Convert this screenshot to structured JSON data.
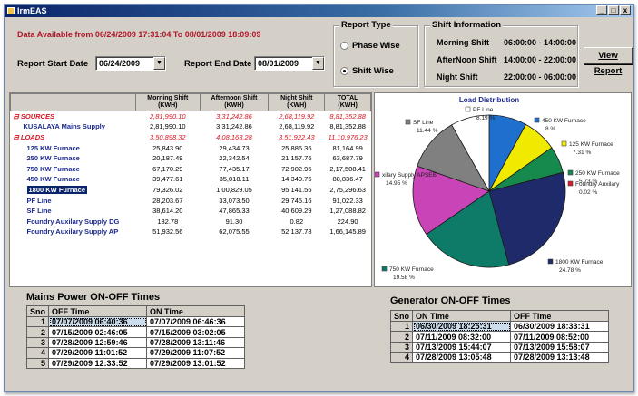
{
  "window": {
    "title": "IrmEAS",
    "min": "_",
    "max": "□",
    "close": "x"
  },
  "header": {
    "availability": "Data Available from 06/24/2009 17:31:04 To 08/01/2009 18:09:09",
    "start_label": "Report Start Date",
    "start_value": "06/24/2009",
    "end_label": "Report End Date",
    "end_value": "08/01/2009"
  },
  "report_type": {
    "title": "Report Type",
    "options": [
      "Phase Wise",
      "Shift Wise"
    ],
    "selected": "Shift Wise"
  },
  "shift_info": {
    "title": "Shift Information",
    "rows": [
      {
        "name": "Morning Shift",
        "time": "06:00:00 - 14:00:00"
      },
      {
        "name": "AfterNoon Shift",
        "time": "14:00:00 - 22:00:00"
      },
      {
        "name": "Night Shift",
        "time": "22:00:00 - 06:00:00"
      }
    ]
  },
  "view_button": "View Report",
  "grid": {
    "headers": [
      "",
      "Morning Shift (KWH)",
      "Afternoon Shift (KWH)",
      "Night Shift (KWH)",
      "TOTAL (KWH)"
    ],
    "rows": [
      {
        "name": "⊟ SOURCES",
        "m": "2,81,990.10",
        "a": "3,31,242.86",
        "n": "2,68,119.92",
        "t": "8,81,352.88",
        "kind": "group"
      },
      {
        "name": "KUSALAYA Mains Supply",
        "m": "2,81,990.10",
        "a": "3,31,242.86",
        "n": "2,68,119.92",
        "t": "8,81,352.88",
        "kind": "item"
      },
      {
        "name": "⊟ LOADS",
        "m": "3,50,898.32",
        "a": "4,08,163.28",
        "n": "3,51,922.43",
        "t": "11,10,976.23",
        "kind": "group"
      },
      {
        "name": "125 KW Furnace",
        "m": "25,843.90",
        "a": "29,434.73",
        "n": "25,886.36",
        "t": "81,164.99",
        "kind": "load"
      },
      {
        "name": "250 KW Furnace",
        "m": "20,187.49",
        "a": "22,342.54",
        "n": "21,157.76",
        "t": "63,687.79",
        "kind": "load"
      },
      {
        "name": "750 KW Furnace",
        "m": "67,170.29",
        "a": "77,435.17",
        "n": "72,902.95",
        "t": "2,17,508.41",
        "kind": "load"
      },
      {
        "name": "450 KW Furnace",
        "m": "39,477.61",
        "a": "35,018.11",
        "n": "14,340.75",
        "t": "88,836.47",
        "kind": "load"
      },
      {
        "name": "1800 KW Furnace",
        "m": "79,326.02",
        "a": "1,00,829.05",
        "n": "95,141.56",
        "t": "2,75,296.63",
        "kind": "sel"
      },
      {
        "name": "PF Line",
        "m": "28,203.67",
        "a": "33,073.50",
        "n": "29,745.16",
        "t": "91,022.33",
        "kind": "load"
      },
      {
        "name": "SF Line",
        "m": "38,614.20",
        "a": "47,865.33",
        "n": "40,609.29",
        "t": "1,27,088.82",
        "kind": "load"
      },
      {
        "name": "Foundry Auxilary Supply DG",
        "m": "132.78",
        "a": "91.30",
        "n": "0.82",
        "t": "224.90",
        "kind": "load"
      },
      {
        "name": "Foundry Auxilary Supply AP",
        "m": "51,932.56",
        "a": "62,075.55",
        "n": "52,137.78",
        "t": "1,66,145.89",
        "kind": "load"
      }
    ]
  },
  "chart_data": {
    "type": "pie",
    "title": "Load Distribution",
    "slices": [
      {
        "label": "450 KW Furnace",
        "pct": "8 %",
        "value": 8.0,
        "color": "#1e6fce"
      },
      {
        "label": "125 KW Furnace",
        "pct": "7.31 %",
        "value": 7.31,
        "color": "#f0ea00"
      },
      {
        "label": "250 KW Furnace",
        "pct": "5.73 %",
        "value": 5.73,
        "color": "#168a4c"
      },
      {
        "label": "Foundry Auxilary",
        "pct": "0.02 %",
        "value": 0.02,
        "color": "#d71e2e"
      },
      {
        "label": "1800 KW Furnace",
        "pct": "24.78 %",
        "value": 24.78,
        "color": "#1f2a6b"
      },
      {
        "label": "750 KW Furnace",
        "pct": "19.58 %",
        "value": 19.58,
        "color": "#0e7a68"
      },
      {
        "label": "xilary Supply APSEB",
        "pct": "14.95 %",
        "value": 14.95,
        "color": "#c944b7"
      },
      {
        "label": "SF Line",
        "pct": "11.44 %",
        "value": 11.44,
        "color": "#808080"
      },
      {
        "label": "PF Line",
        "pct": "8.19 %",
        "value": 8.19,
        "color": "#ffffff"
      }
    ]
  },
  "mains": {
    "title": "Mains Power ON-OFF Times",
    "headers": [
      "Sno",
      "OFF Time",
      "ON Time"
    ],
    "rows": [
      [
        "1",
        "07/07/2009 06:40:36",
        "07/07/2009 06:46:36"
      ],
      [
        "2",
        "07/15/2009 02:46:05",
        "07/15/2009 03:02:05"
      ],
      [
        "3",
        "07/28/2009 12:59:46",
        "07/28/2009 13:11:46"
      ],
      [
        "4",
        "07/29/2009 11:01:52",
        "07/29/2009 11:07:52"
      ],
      [
        "5",
        "07/29/2009 12:33:52",
        "07/29/2009 13:01:52"
      ]
    ]
  },
  "generator": {
    "title": "Generator ON-OFF Times",
    "headers": [
      "Sno",
      "ON Time",
      "OFF Time"
    ],
    "rows": [
      [
        "1",
        "06/30/2009 18:25:31",
        "06/30/2009 18:33:31"
      ],
      [
        "2",
        "07/11/2009 08:32:00",
        "07/11/2009 08:52:00"
      ],
      [
        "3",
        "07/13/2009 15:44:07",
        "07/13/2009 15:58:07"
      ],
      [
        "4",
        "07/28/2009 13:05:48",
        "07/28/2009 13:13:48"
      ]
    ]
  }
}
